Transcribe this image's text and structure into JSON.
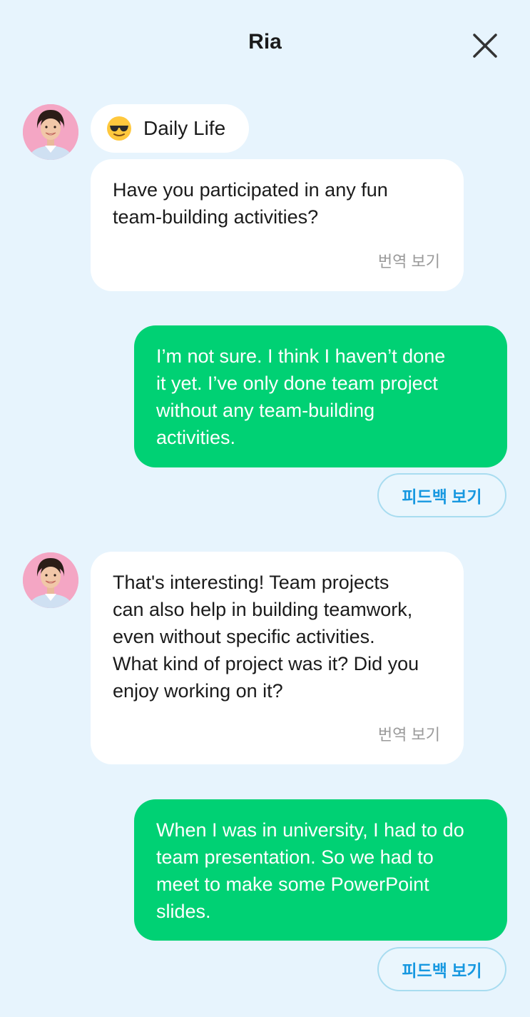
{
  "header": {
    "title": "Ria",
    "close_icon": "close-icon"
  },
  "topic": {
    "icon": "sunglasses-emoji-icon",
    "label": "Daily Life"
  },
  "messages": [
    {
      "sender": "bot",
      "text": "Have you participated in any fun\nteam-building activities?",
      "translate_label": "번역 보기"
    },
    {
      "sender": "user",
      "text": "I’m not sure. I think I haven’t done\nit yet. I’ve only done team project\nwithout any team-building\nactivities.",
      "feedback_label": "피드백 보기"
    },
    {
      "sender": "bot",
      "text": "That's interesting! Team projects\ncan also help in building teamwork,\neven without specific activities.\nWhat kind of project was it? Did you\nenjoy working on it?",
      "translate_label": "번역 보기"
    },
    {
      "sender": "user",
      "text": "When I was in university, I had to do\nteam presentation. So we had to\nmeet to make some PowerPoint\nslides.",
      "feedback_label": "피드백 보기"
    }
  ],
  "colors": {
    "background": "#e7f4fd",
    "user_bubble": "#00d174",
    "bot_bubble": "#ffffff",
    "feedback_text": "#1798e0",
    "feedback_border": "#a8dcf0"
  }
}
